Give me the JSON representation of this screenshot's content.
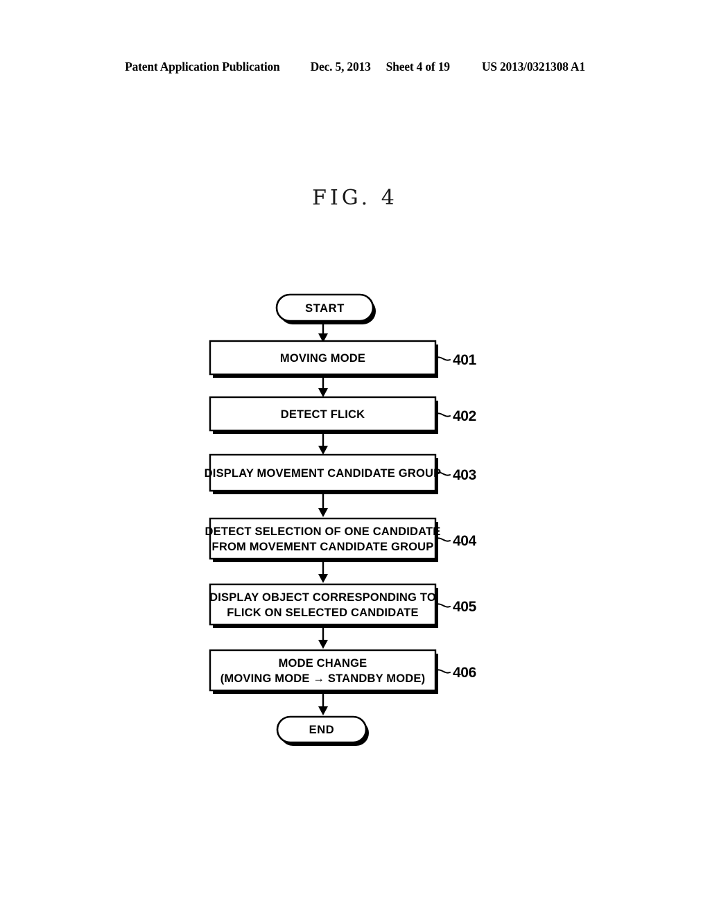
{
  "header": {
    "publication": "Patent Application Publication",
    "date": "Dec. 5, 2013",
    "sheet": "Sheet 4 of 19",
    "publication_number": "US 2013/0321308 A1"
  },
  "figure": {
    "title": "FIG. 4"
  },
  "flowchart": {
    "start_label": "START",
    "end_label": "END",
    "steps": [
      {
        "ref": "401",
        "line1": "MOVING MODE",
        "line2": ""
      },
      {
        "ref": "402",
        "line1": "DETECT FLICK",
        "line2": ""
      },
      {
        "ref": "403",
        "line1": "DISPLAY MOVEMENT CANDIDATE GROUP",
        "line2": ""
      },
      {
        "ref": "404",
        "line1": "DETECT SELECTION OF ONE CANDIDATE",
        "line2": "FROM MOVEMENT CANDIDATE GROUP"
      },
      {
        "ref": "405",
        "line1": "DISPLAY OBJECT CORRESPONDING TO",
        "line2": "FLICK ON SELECTED CANDIDATE"
      },
      {
        "ref": "406",
        "line1": "MODE CHANGE",
        "line2": "(MOVING MODE → STANDBY MODE)"
      }
    ]
  },
  "colors": {
    "ink": "#000000",
    "paper": "#ffffff"
  }
}
